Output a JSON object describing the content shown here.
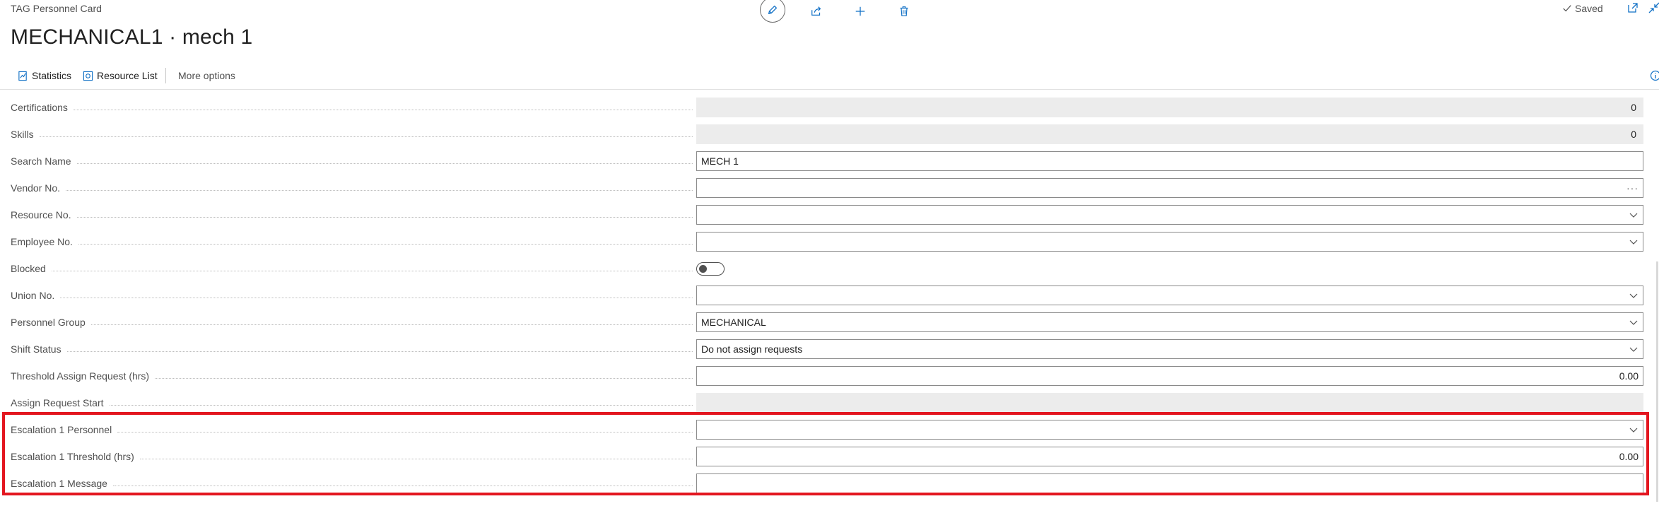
{
  "header": {
    "breadcrumb": "TAG Personnel Card",
    "title": "MECHANICAL1 · mech 1",
    "saved_label": "Saved"
  },
  "toolbar": {
    "icons": [
      "edit-icon",
      "share-icon",
      "add-icon",
      "delete-icon"
    ]
  },
  "actions": {
    "statistics": "Statistics",
    "resource_list": "Resource List",
    "more_options": "More options"
  },
  "fields": [
    {
      "label": "Certifications",
      "value": "0",
      "kind": "readonly"
    },
    {
      "label": "Skills",
      "value": "0",
      "kind": "readonly"
    },
    {
      "label": "Search Name",
      "value": "MECH 1",
      "kind": "text"
    },
    {
      "label": "Vendor No.",
      "value": "",
      "kind": "lookup"
    },
    {
      "label": "Resource No.",
      "value": "",
      "kind": "dropdown"
    },
    {
      "label": "Employee No.",
      "value": "",
      "kind": "dropdown"
    },
    {
      "label": "Blocked",
      "value": "",
      "kind": "toggle"
    },
    {
      "label": "Union No.",
      "value": "",
      "kind": "dropdown"
    },
    {
      "label": "Personnel Group",
      "value": "MECHANICAL",
      "kind": "dropdown"
    },
    {
      "label": "Shift Status",
      "value": "Do not assign requests",
      "kind": "dropdown"
    },
    {
      "label": "Threshold Assign Request (hrs)",
      "value": "0.00",
      "kind": "number"
    },
    {
      "label": "Assign Request Start",
      "value": "",
      "kind": "readonly-empty"
    },
    {
      "label": "Escalation 1 Personnel",
      "value": "",
      "kind": "dropdown"
    },
    {
      "label": "Escalation 1 Threshold (hrs)",
      "value": "0.00",
      "kind": "number"
    },
    {
      "label": "Escalation 1 Message",
      "value": "",
      "kind": "text"
    }
  ],
  "colors": {
    "accent": "#0f6fc5",
    "highlight": "#e3161f"
  }
}
